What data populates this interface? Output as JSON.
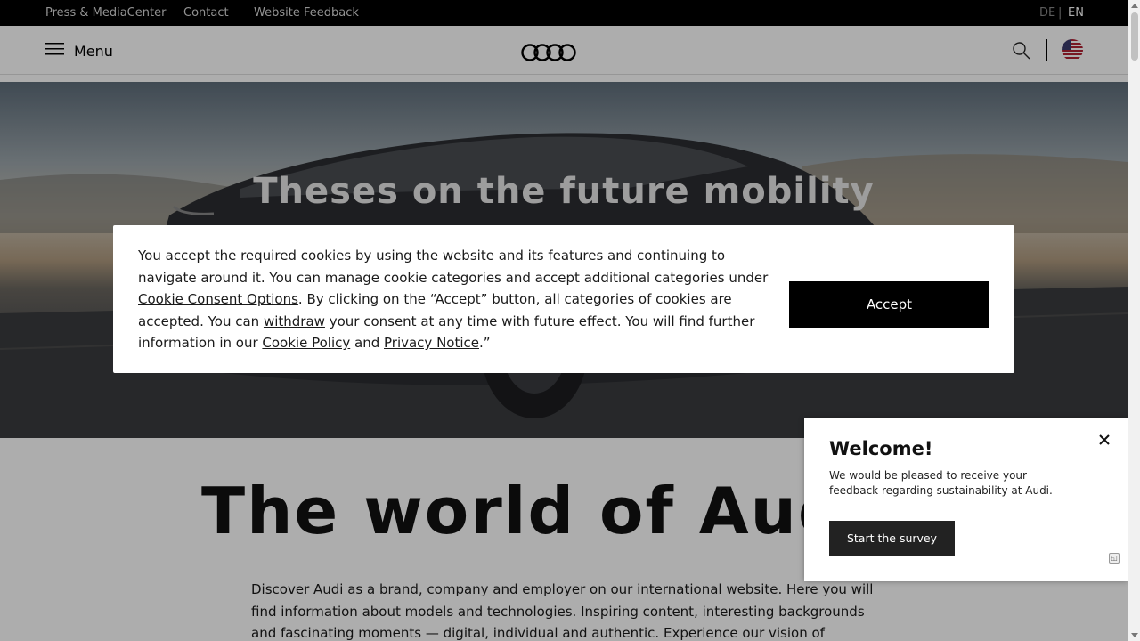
{
  "topbar": {
    "links": [
      "Press & MediaCenter",
      "Contact",
      "Website Feedback"
    ],
    "lang_de": "DE",
    "lang_sep": "|",
    "lang_en": "EN"
  },
  "header": {
    "menu_label": "Menu",
    "logo_icon": "audi-rings-logo",
    "search_icon": "search-icon",
    "flag_icon": "us-flag-icon"
  },
  "hero": {
    "title": "Theses on the future mobility"
  },
  "main": {
    "heading": "The world of Audi",
    "intro": "Discover Audi as a brand, company and employer on our international website. Here you will find information about models and technologies. Inspiring content, interesting backgrounds and fascinating moments — digital, individual and authentic. Experience our vision of mobility"
  },
  "cookie_banner": {
    "text_1": "You accept the required cookies by using the website and its features and continuing to navigate around it. You can manage cookie categories and accept additional categories under ",
    "link_consent_options": "Cookie Consent Options",
    "text_2": ". By clicking on the “Accept” button, all categories of cookies are accepted. You can ",
    "link_withdraw": "withdraw",
    "text_3": " your consent at any time with future effect. You will find further information in our ",
    "link_cookie_policy": "Cookie Policy",
    "text_4": " and ",
    "link_privacy": "Privacy Notice",
    "text_5": ".”",
    "accept_label": "Accept"
  },
  "survey": {
    "title": "Welcome!",
    "body": "We would be pleased to receive your feedback regarding sustainability at Audi.",
    "button_label": "Start the survey",
    "close_icon": "close-icon"
  },
  "colors": {
    "topbar_bg": "#000000",
    "accept_bg": "#000000",
    "survey_button_bg": "#222222"
  }
}
